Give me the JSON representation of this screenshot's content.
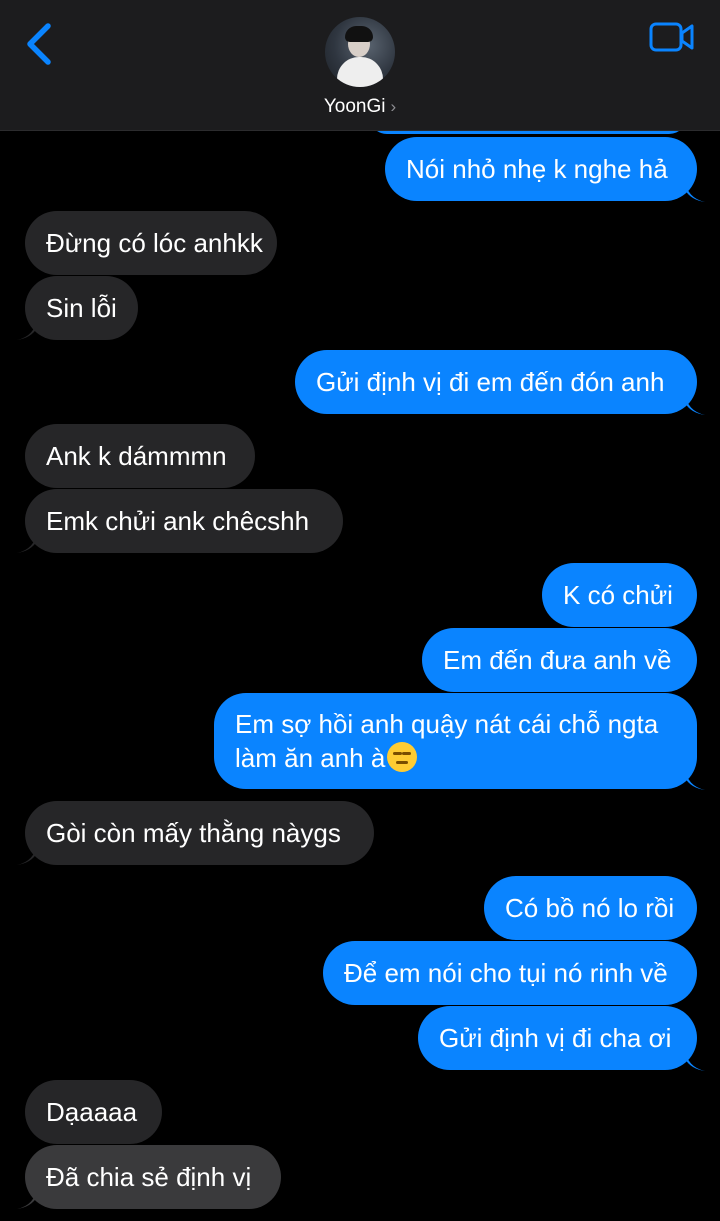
{
  "header": {
    "contact_name": "YoonGi",
    "chevron": "›",
    "icons": {
      "back": "chevron-left-icon",
      "video": "video-camera-icon"
    },
    "accent_color": "#0a84ff"
  },
  "messages": [
    {
      "from": "me",
      "text": "Nói nhỏ nhẹ k nghe hả"
    },
    {
      "from": "them",
      "text": "Đừng có lóc anhkk"
    },
    {
      "from": "them",
      "text": "Sin lỗi"
    },
    {
      "from": "me",
      "text": "Gửi định vị đi em đến đón anh"
    },
    {
      "from": "them",
      "text": "Ank k dámmmn"
    },
    {
      "from": "them",
      "text": "Emk chửi ank chêcshh"
    },
    {
      "from": "me",
      "text": "K có chửi"
    },
    {
      "from": "me",
      "text": "Em đến đưa anh về"
    },
    {
      "from": "me",
      "text": "Em sợ hồi anh quậy nát cái chỗ ngta làm ăn anh à",
      "emoji": "expressionless-face-emoji"
    },
    {
      "from": "them",
      "text": "Gòi còn mấy thằng nàygs"
    },
    {
      "from": "me",
      "text": "Có bồ nó lo rồi"
    },
    {
      "from": "me",
      "text": "Để em nói cho tụi nó rinh về"
    },
    {
      "from": "me",
      "text": "Gửi định vị đi cha ơi"
    },
    {
      "from": "them",
      "text": "Dạaaaa"
    },
    {
      "from": "them",
      "text": "Đã chia sẻ định vị"
    }
  ],
  "colors": {
    "sent_bubble": "#0a84ff",
    "received_bubble": "#262628",
    "background": "#000000"
  }
}
